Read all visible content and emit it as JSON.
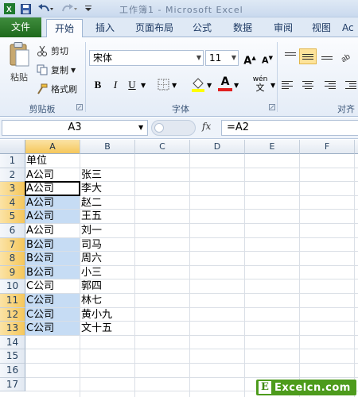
{
  "window": {
    "title": "工作簿1 - Microsoft Excel"
  },
  "quick_access": {
    "undo_icon": "undo-icon",
    "redo_icon": "redo-icon",
    "save_icon": "save-icon"
  },
  "tabs": [
    "文件",
    "开始",
    "插入",
    "页面布局",
    "公式",
    "数据",
    "审阅",
    "视图",
    "Ac"
  ],
  "clipboard": {
    "paste": "粘贴",
    "cut": "剪切",
    "copy": "复制",
    "format_painter": "格式刷",
    "group": "剪贴板"
  },
  "font": {
    "name": "宋体",
    "size": "11",
    "group": "字体",
    "bold": "B",
    "italic": "I",
    "underline": "U",
    "grow": "A",
    "shrink": "A",
    "color_letter": "A",
    "wen": "wén"
  },
  "alignment": {
    "group": "对齐"
  },
  "formula_bar": {
    "name_box": "A3",
    "fx": "fx",
    "formula": "=A2"
  },
  "colors": {
    "accent_file_tab": "#2a7a28",
    "selection_fill": "#c6dcf4",
    "header_highlight": "#f5c75b",
    "font_color_bar": "#e02020",
    "fill_color_bar": "#ffff00"
  },
  "grid": {
    "columns": [
      "A",
      "B",
      "C",
      "D",
      "E",
      "F"
    ],
    "rows": [
      "1",
      "2",
      "3",
      "4",
      "5",
      "6",
      "7",
      "8",
      "9",
      "10",
      "11",
      "12",
      "13",
      "14",
      "15",
      "16",
      "17"
    ],
    "col_a": [
      "单位",
      "A公司",
      "A公司",
      "A公司",
      "A公司",
      "A公司",
      "B公司",
      "B公司",
      "B公司",
      "C公司",
      "C公司",
      "C公司",
      "C公司"
    ],
    "col_b": [
      "",
      "张三",
      "李大",
      "赵二",
      "王五",
      "刘一",
      "司马",
      "周六",
      "小三",
      "郭四",
      "林七",
      "黄小九",
      "文十五"
    ]
  },
  "watermark": {
    "letter": "E",
    "text": "Excelcn.com"
  }
}
